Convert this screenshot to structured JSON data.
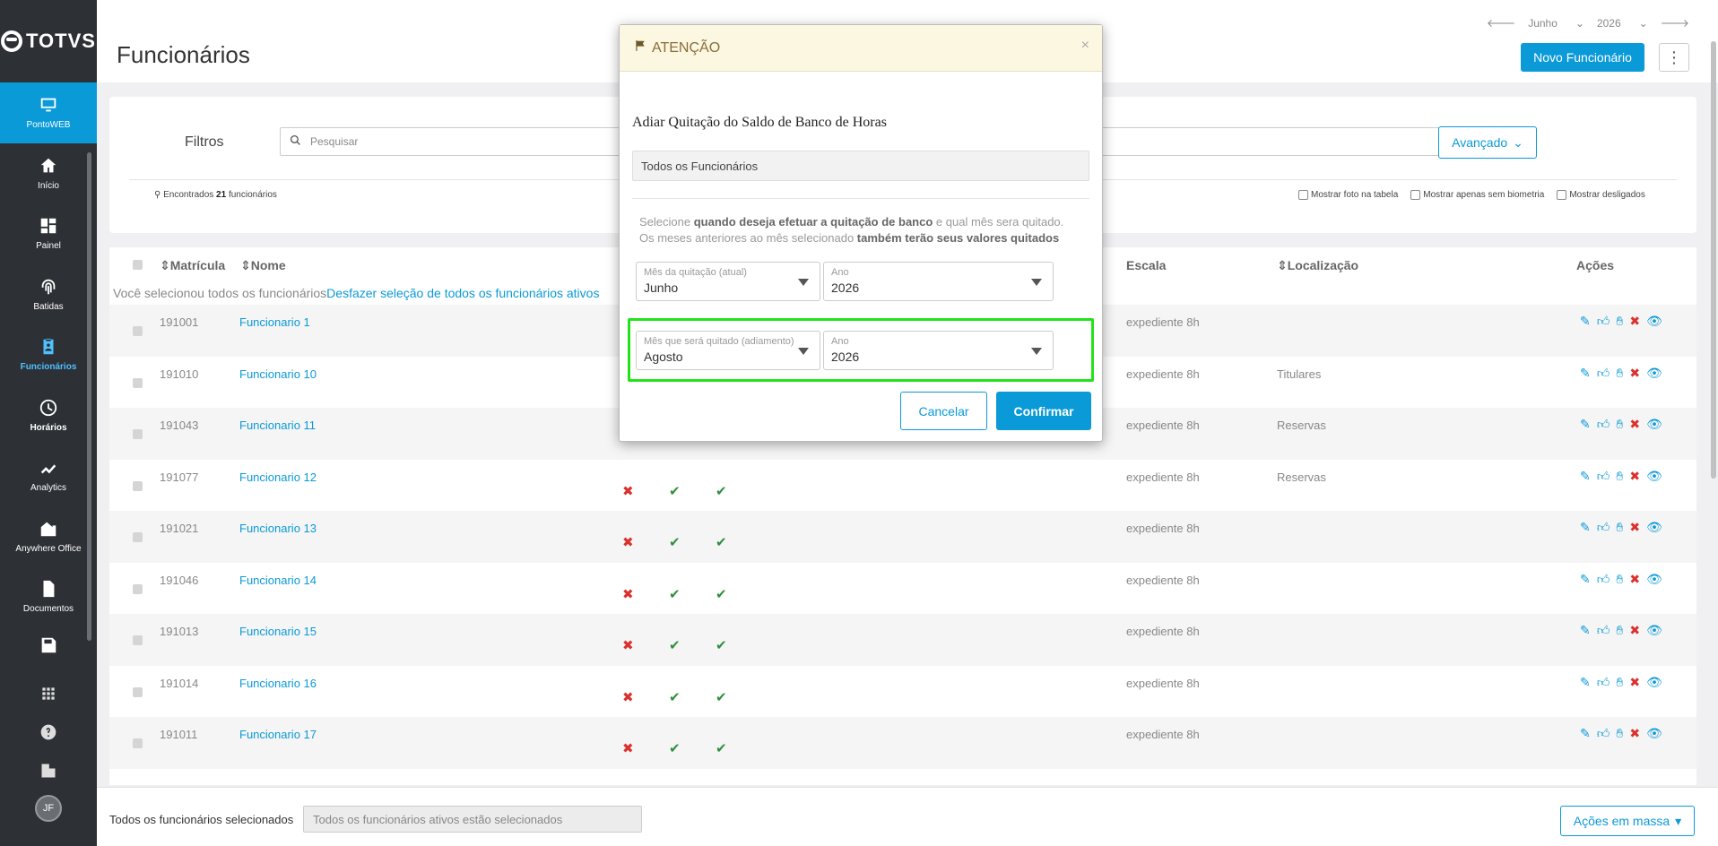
{
  "sidebar": {
    "logo": "TOTVS",
    "items": [
      {
        "label": "PontoWEB",
        "icon": "monitor-icon"
      },
      {
        "label": "Início",
        "icon": "home-icon"
      },
      {
        "label": "Painel",
        "icon": "dashboard-icon"
      },
      {
        "label": "Batidas",
        "icon": "fingerprint-icon"
      },
      {
        "label": "Funcionários",
        "icon": "badge-icon"
      },
      {
        "label": "Horários",
        "icon": "clock-icon"
      },
      {
        "label": "Analytics",
        "icon": "trend-icon"
      },
      {
        "label": "Anywhere Office",
        "icon": "building-icon"
      },
      {
        "label": "Documentos",
        "icon": "document-icon"
      }
    ],
    "avatar": "JF"
  },
  "header": {
    "title": "Funcionários",
    "month": "Junho",
    "year": "2026",
    "new_button": "Novo Funcionário",
    "more_button": "⋮"
  },
  "filters": {
    "label": "Filtros",
    "search_placeholder": "Pesquisar",
    "advanced": "Avançado",
    "found_prefix": "Encontrados",
    "found_count": "21",
    "found_suffix": "funcionários",
    "show_photo": "Mostrar foto na tabela",
    "show_no_bio": "Mostrar apenas sem biometria",
    "show_dismissed": "Mostrar desligados"
  },
  "table": {
    "headers": {
      "matricula": "Matrícula",
      "nome": "Nome",
      "escala": "Escala",
      "localizacao": "Localização",
      "acoes": "Ações"
    },
    "selected_note": "Você selecionou todos os funcionários",
    "undo_link": "Desfazer seleção de todos os funcionários ativos",
    "rows": [
      {
        "id": "191001",
        "name": "Funcionario 1",
        "escala": "expediente 8h",
        "loc": ""
      },
      {
        "id": "191010",
        "name": "Funcionario 10",
        "escala": "expediente 8h",
        "loc": "Titulares"
      },
      {
        "id": "191043",
        "name": "Funcionario 11",
        "escala": "expediente 8h",
        "loc": "Reservas"
      },
      {
        "id": "191077",
        "name": "Funcionario 12",
        "escala": "expediente 8h",
        "loc": "Reservas"
      },
      {
        "id": "191021",
        "name": "Funcionario 13",
        "escala": "expediente 8h",
        "loc": ""
      },
      {
        "id": "191046",
        "name": "Funcionario 14",
        "escala": "expediente 8h",
        "loc": ""
      },
      {
        "id": "191013",
        "name": "Funcionario 15",
        "escala": "expediente 8h",
        "loc": ""
      },
      {
        "id": "191014",
        "name": "Funcionario 16",
        "escala": "expediente 8h",
        "loc": ""
      },
      {
        "id": "191011",
        "name": "Funcionario 17",
        "escala": "expediente 8h",
        "loc": ""
      }
    ]
  },
  "bottom": {
    "label": "Todos os funcionários selecionados",
    "field": "Todos os funcionários ativos estão selecionados",
    "mass_button": "Ações em massa"
  },
  "modal": {
    "header": "ATENÇÃO",
    "close": "×",
    "title": "Adiar Quitação do Saldo de Banco de Horas",
    "scope": "Todos os Funcionários",
    "desc_1": "Selecione ",
    "desc_b1": "quando deseja efetuar a quitação de banco",
    "desc_2": " e qual mês sera quitado. Os meses anteriores ao mês selecionado ",
    "desc_b2": "também terão seus valores quitados",
    "current_month_label": "Mês da quitação (atual)",
    "current_month": "Junho",
    "year_label": "Ano",
    "current_year": "2026",
    "target_month_label": "Mês que será quitado (adiamento)",
    "target_month": "Agosto",
    "target_year": "2026",
    "cancel": "Cancelar",
    "confirm": "Confirmar"
  },
  "colors": {
    "accent": "#0b9ad8",
    "sidebar": "#2d3035",
    "highlight": "#22e31a",
    "error": "#d9322e",
    "success": "#2f8f3f"
  }
}
